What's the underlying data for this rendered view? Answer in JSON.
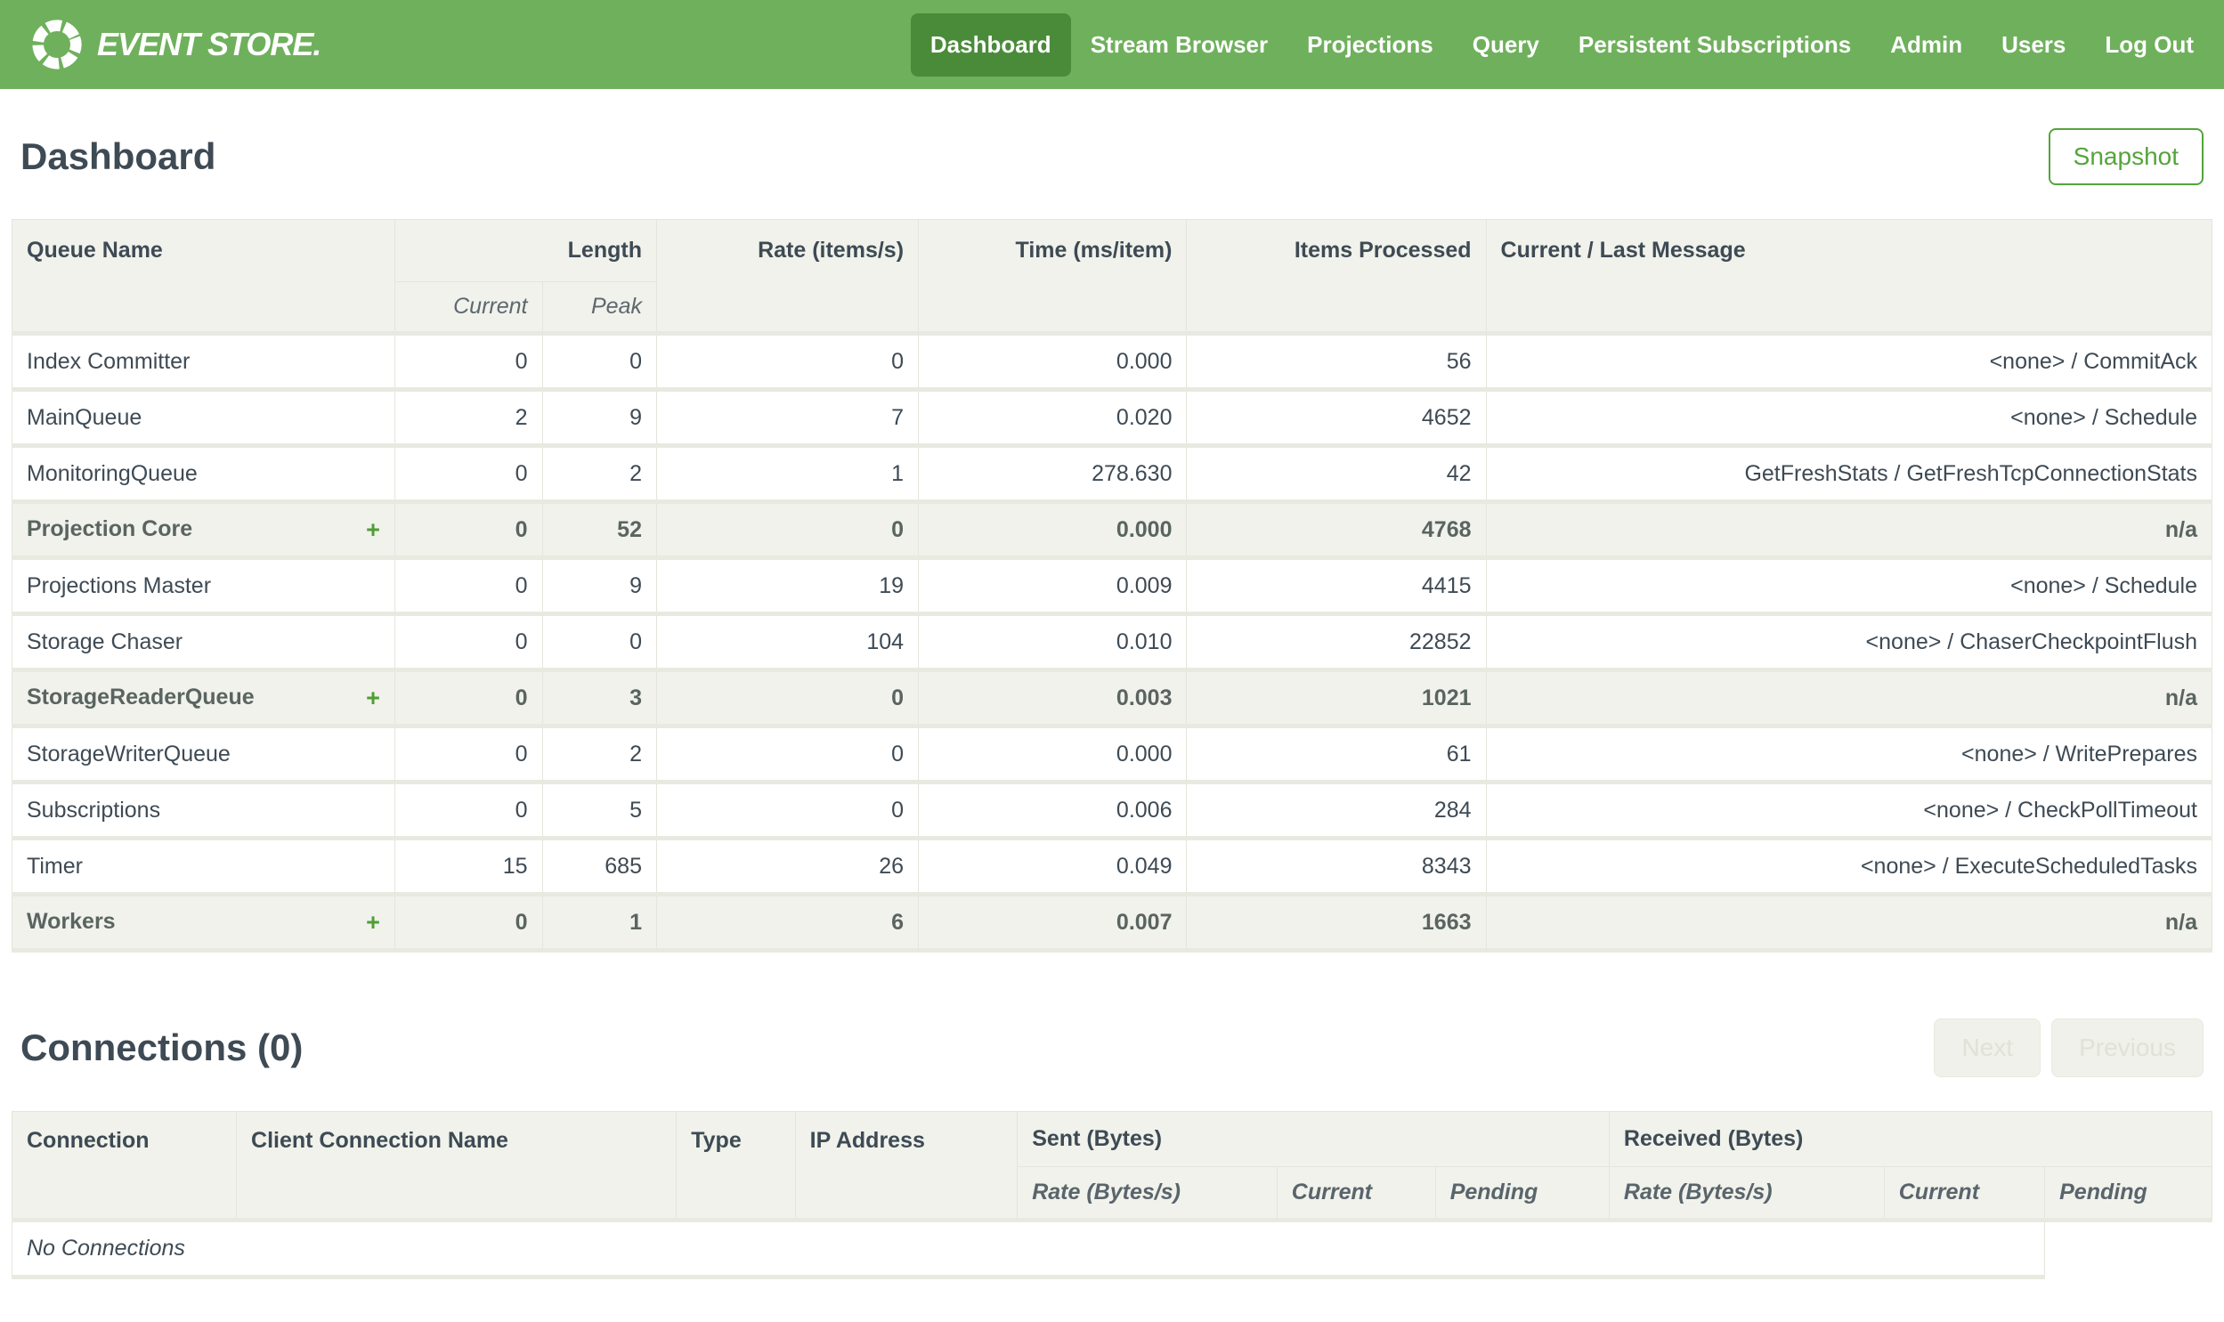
{
  "navbar": {
    "brand": "EVENT STORE.",
    "items": [
      {
        "label": "Dashboard",
        "active": true
      },
      {
        "label": "Stream Browser",
        "active": false
      },
      {
        "label": "Projections",
        "active": false
      },
      {
        "label": "Query",
        "active": false
      },
      {
        "label": "Persistent Subscriptions",
        "active": false
      },
      {
        "label": "Admin",
        "active": false
      },
      {
        "label": "Users",
        "active": false
      },
      {
        "label": "Log Out",
        "active": false
      }
    ]
  },
  "page": {
    "title": "Dashboard",
    "snapshot_label": "Snapshot"
  },
  "queue_table": {
    "headers": {
      "queue_name": "Queue Name",
      "length": "Length",
      "current": "Current",
      "peak": "Peak",
      "rate": "Rate (items/s)",
      "time": "Time (ms/item)",
      "items_processed": "Items Processed",
      "message": "Current / Last Message"
    },
    "expand_glyph": "+",
    "rows": [
      {
        "name": "Index Committer",
        "group": false,
        "current": "0",
        "peak": "0",
        "rate": "0",
        "time": "0.000",
        "items": "56",
        "message": "<none> / CommitAck"
      },
      {
        "name": "MainQueue",
        "group": false,
        "current": "2",
        "peak": "9",
        "rate": "7",
        "time": "0.020",
        "items": "4652",
        "message": "<none> / Schedule"
      },
      {
        "name": "MonitoringQueue",
        "group": false,
        "current": "0",
        "peak": "2",
        "rate": "1",
        "time": "278.630",
        "items": "42",
        "message": "GetFreshStats / GetFreshTcpConnectionStats"
      },
      {
        "name": "Projection Core",
        "group": true,
        "current": "0",
        "peak": "52",
        "rate": "0",
        "time": "0.000",
        "items": "4768",
        "message": "n/a"
      },
      {
        "name": "Projections Master",
        "group": false,
        "current": "0",
        "peak": "9",
        "rate": "19",
        "time": "0.009",
        "items": "4415",
        "message": "<none> / Schedule"
      },
      {
        "name": "Storage Chaser",
        "group": false,
        "current": "0",
        "peak": "0",
        "rate": "104",
        "time": "0.010",
        "items": "22852",
        "message": "<none> / ChaserCheckpointFlush"
      },
      {
        "name": "StorageReaderQueue",
        "group": true,
        "current": "0",
        "peak": "3",
        "rate": "0",
        "time": "0.003",
        "items": "1021",
        "message": "n/a"
      },
      {
        "name": "StorageWriterQueue",
        "group": false,
        "current": "0",
        "peak": "2",
        "rate": "0",
        "time": "0.000",
        "items": "61",
        "message": "<none> / WritePrepares"
      },
      {
        "name": "Subscriptions",
        "group": false,
        "current": "0",
        "peak": "5",
        "rate": "0",
        "time": "0.006",
        "items": "284",
        "message": "<none> / CheckPollTimeout"
      },
      {
        "name": "Timer",
        "group": false,
        "current": "15",
        "peak": "685",
        "rate": "26",
        "time": "0.049",
        "items": "8343",
        "message": "<none> / ExecuteScheduledTasks"
      },
      {
        "name": "Workers",
        "group": true,
        "current": "0",
        "peak": "1",
        "rate": "6",
        "time": "0.007",
        "items": "1663",
        "message": "n/a"
      }
    ]
  },
  "connections": {
    "title": "Connections (0)",
    "next_label": "Next",
    "previous_label": "Previous",
    "headers": {
      "connection": "Connection",
      "client_connection_name": "Client Connection Name",
      "type": "Type",
      "ip_address": "IP Address",
      "sent": "Sent (Bytes)",
      "received": "Received (Bytes)",
      "rate": "Rate (Bytes/s)",
      "current": "Current",
      "pending": "Pending"
    },
    "empty_message": "No Connections"
  },
  "colors": {
    "nav_green": "#6fb05c",
    "nav_active_green": "#4a8b3a",
    "accent_green": "#55a43c",
    "header_bg": "#f0f2eb",
    "text_slate": "#3e4a54"
  }
}
